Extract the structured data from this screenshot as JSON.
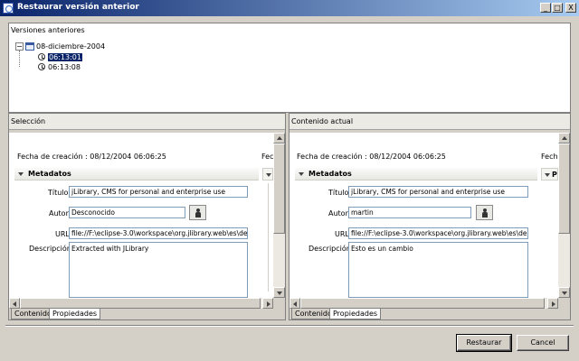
{
  "window": {
    "title": "Restaurar versión anterior",
    "controls": {
      "minimize": "_",
      "maximize": "□",
      "close": "X"
    }
  },
  "versions": {
    "label": "Versiones anteriores",
    "date_node": "08-diciembre-2004",
    "times": [
      "06:13:01",
      "06:13:08"
    ],
    "selected_index": 0
  },
  "left": {
    "section": "Selección",
    "fecha": "Fecha de creación : 08/12/2004 06:06:25",
    "fecha_cut": "Fech",
    "meta_title": "Metadatos",
    "labels": {
      "titulo": "Título",
      "autor": "Autor",
      "url": "URL",
      "descripcion": "Descripción"
    },
    "values": {
      "titulo": "jLibrary, CMS for personal and enterprise use",
      "autor": "Desconocido",
      "url": "file://F:\\eclipse-3.0\\workspace\\org.jlibrary.web\\es\\de",
      "descripcion": "Extracted with JLibrary"
    },
    "tabs": [
      "Contenido",
      "Propiedades"
    ],
    "active_tab": 1
  },
  "right": {
    "section": "Contenido actual",
    "fecha": "Fecha de creación : 08/12/2004 06:06:25",
    "fecha_cut": "Fech",
    "meta_title": "Metadatos",
    "labels": {
      "titulo": "Título",
      "autor": "Autor",
      "url": "URL",
      "descripcion": "Descripción"
    },
    "values": {
      "titulo": "jLibrary, CMS for personal and enterprise use",
      "autor": "martin",
      "url": "file://F:\\eclipse-3.0\\workspace\\org.jlibrary.web\\es\\de",
      "descripcion": "Esto es un cambio"
    },
    "tabs": [
      "Contenido",
      "Propiedades"
    ],
    "active_tab": 1
  },
  "buttons": {
    "restore": "Restaurar",
    "cancel": "Cancel"
  },
  "colors": {
    "title_start": "#0a246a",
    "title_end": "#a6caf0",
    "selection": "#0a246a",
    "face": "#d4d0c8"
  }
}
